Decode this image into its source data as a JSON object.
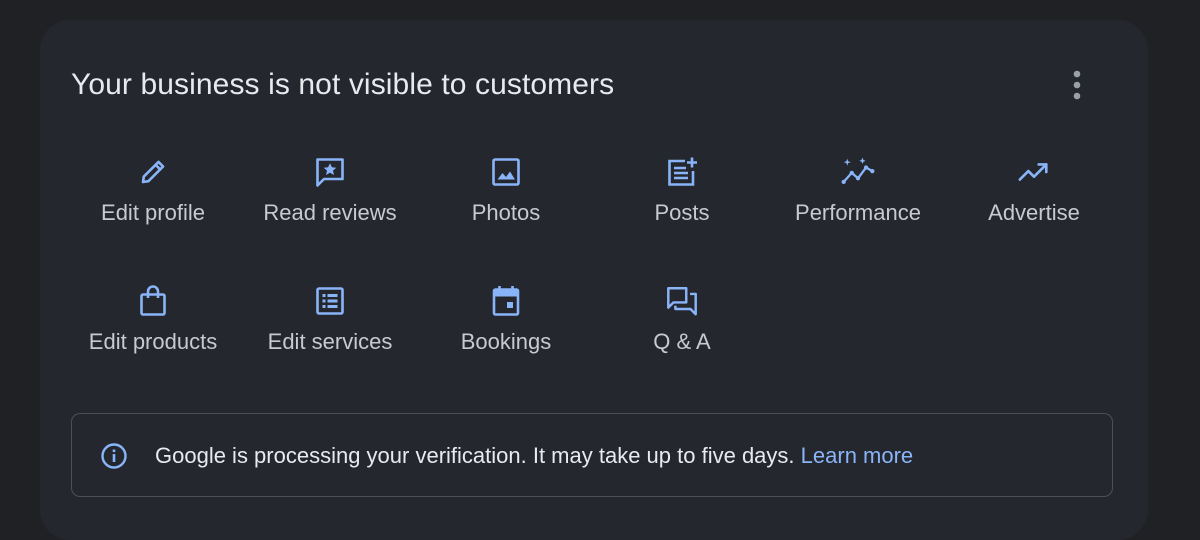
{
  "card": {
    "title": "Your business is not visible to customers",
    "more_options_icon": "more-vert-icon"
  },
  "actions": [
    {
      "label": "Edit profile",
      "icon": "pencil-icon"
    },
    {
      "label": "Read reviews",
      "icon": "review-star-icon"
    },
    {
      "label": "Photos",
      "icon": "photo-icon"
    },
    {
      "label": "Posts",
      "icon": "post-add-icon"
    },
    {
      "label": "Performance",
      "icon": "performance-sparkle-icon"
    },
    {
      "label": "Advertise",
      "icon": "trending-up-icon"
    },
    {
      "label": "Edit products",
      "icon": "shopping-bag-icon"
    },
    {
      "label": "Edit services",
      "icon": "list-icon"
    },
    {
      "label": "Bookings",
      "icon": "calendar-icon"
    },
    {
      "label": "Q & A",
      "icon": "forum-icon"
    }
  ],
  "notice": {
    "icon": "info-icon",
    "message": "Google is processing your verification. It may take up to five days.",
    "link_label": "Learn more"
  },
  "colors": {
    "page_background": "#202124",
    "card_background": "#24272e",
    "icon_accent": "#8ab4f8",
    "label_text": "#c8cace",
    "link": "#8ab4f8"
  }
}
